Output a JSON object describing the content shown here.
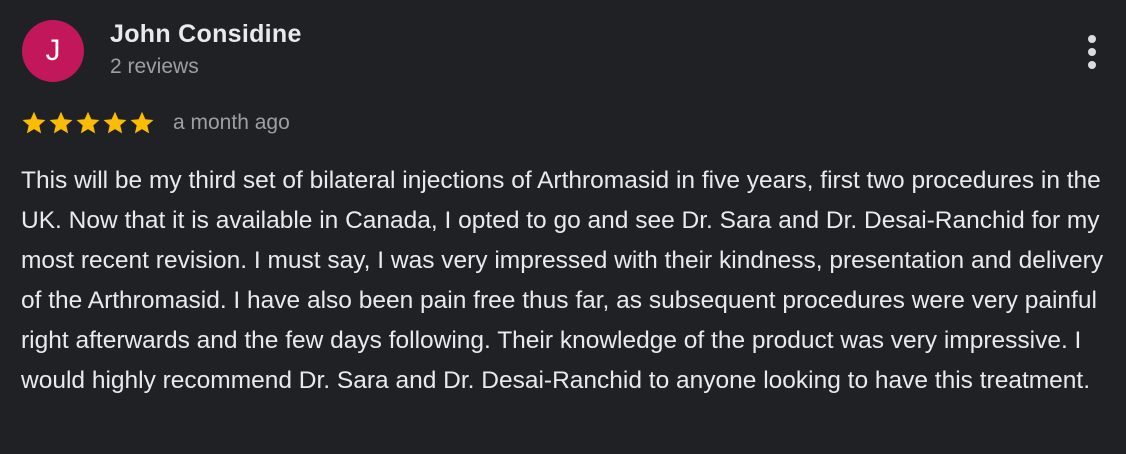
{
  "reviewer": {
    "avatar_initial": "J",
    "avatar_color": "#c2185b",
    "name": "John Considine",
    "review_count": "2 reviews"
  },
  "menu": {
    "icon": "more-vert-icon"
  },
  "rating": {
    "stars": 5,
    "max_stars": 5,
    "star_color": "#fbbc04",
    "time_ago": "a month ago"
  },
  "review": {
    "text": "This will be my third set of bilateral injections of Arthromasid in five years, first two procedures in the UK. Now that it is available in Canada, I opted to go and see Dr. Sara and Dr. Desai-Ranchid for my most recent revision. I must say, I was very impressed with their kindness, presentation and delivery of the Arthromasid. I have also been pain free thus far, as subsequent procedures were very painful right afterwards and the few days following. Their knowledge of the product was very impressive. I would highly recommend Dr. Sara and Dr. Desai-Ranchid to anyone looking to have this treatment."
  }
}
